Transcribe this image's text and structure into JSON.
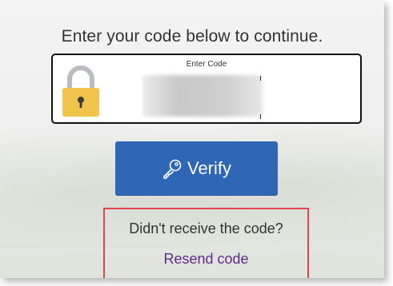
{
  "instruction": "Enter your code below to continue.",
  "code_field": {
    "label": "Enter Code",
    "value_masked": true
  },
  "verify_button": {
    "label": "Verify",
    "color": "#2f66b6",
    "icon": "key-icon"
  },
  "resend": {
    "question": "Didn't receive the code?",
    "link_label": "Resend code",
    "link_color": "#5b2b88",
    "highlight_color": "#e0454f"
  },
  "lock_icon": {
    "color": "#f2c34a",
    "name": "padlock-icon"
  }
}
